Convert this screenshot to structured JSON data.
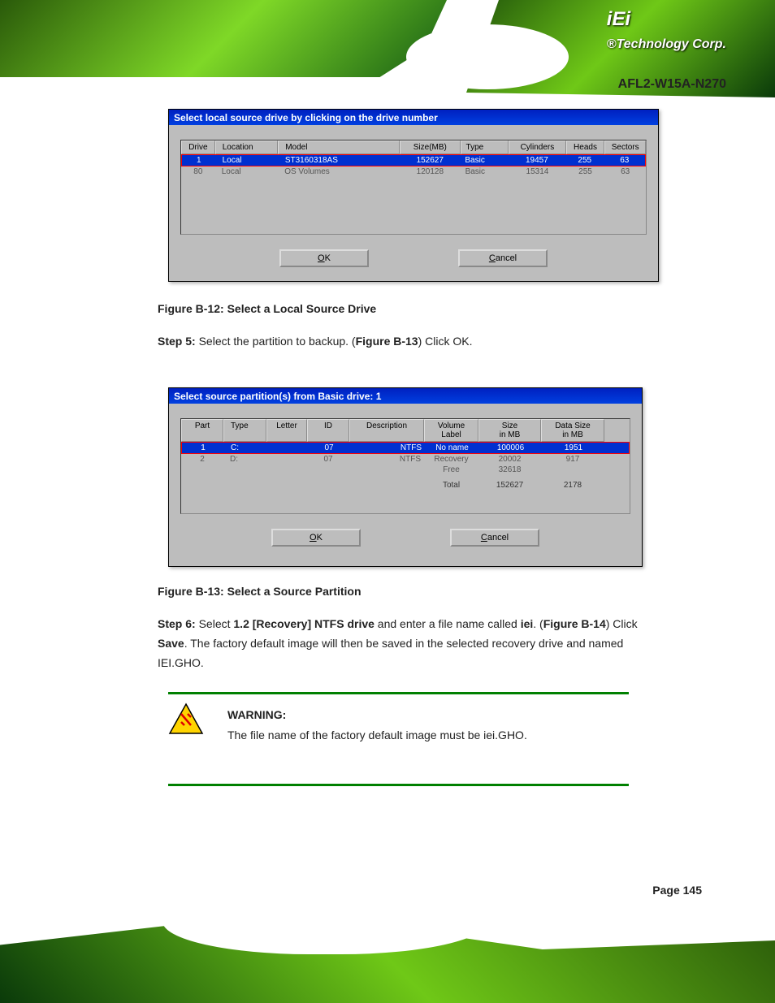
{
  "header": {
    "logo_main": "iEi",
    "logo_sub": "®Technology Corp.",
    "product": "AFL2-W15A-N270"
  },
  "dialog1": {
    "title": "Select local source drive by clicking on the drive number",
    "cols": [
      "Drive",
      "Location",
      "Model",
      "Size(MB)",
      "Type",
      "Cylinders",
      "Heads",
      "Sectors"
    ],
    "row1": [
      "1",
      "Local",
      "ST3160318AS",
      "152627",
      "Basic",
      "19457",
      "255",
      "63"
    ],
    "row2": [
      "80",
      "Local",
      "OS Volumes",
      "120128",
      "Basic",
      "15314",
      "255",
      "63"
    ],
    "ok": "OK",
    "cancel": "Cancel"
  },
  "fig1": "Figure B-12: Select a Local Source Drive",
  "step5": {
    "lead": "Step 5:",
    "t1": "Select the partition to backup. (",
    "ref": "Figure B-13",
    "t2": ") Click OK."
  },
  "dialog2": {
    "title": "Select source partition(s) from Basic drive: 1",
    "cols_l1": [
      "Part",
      "Type",
      "Letter",
      "ID",
      "Description",
      "Volume",
      "Size",
      "Data Size"
    ],
    "cols_l2": [
      "",
      "",
      "",
      "",
      "",
      "Label",
      "in MB",
      "in MB"
    ],
    "row1": [
      "1",
      "C:",
      "",
      "07",
      "NTFS",
      "No name",
      "100006",
      "1951"
    ],
    "row2": [
      "2",
      "D:",
      "",
      "07",
      "NTFS",
      "Recovery",
      "20002",
      "917"
    ],
    "row3": [
      "",
      "",
      "",
      "",
      "",
      "Free",
      "32618",
      ""
    ],
    "row4": [
      "",
      "",
      "",
      "",
      "",
      "Total",
      "152627",
      "2178"
    ],
    "ok": "OK",
    "cancel": "Cancel"
  },
  "fig2": "Figure B-13: Select a Source Partition",
  "step6": {
    "lead": "Step 6:",
    "t1": "Select ",
    "b1": "1.2 [Recovery] NTFS drive",
    "t2": " and enter a file name called ",
    "b2": "iei",
    "t3": ". (",
    "ref": "Figure B-14",
    "t4": ") Click ",
    "b3": "Save",
    "t5": ". The factory default image will then be saved in the selected recovery drive and named IEI.GHO."
  },
  "warning": {
    "heading": "WARNING:",
    "body": "The file name of the factory default image must be iei.GHO."
  },
  "page": "Page 145"
}
